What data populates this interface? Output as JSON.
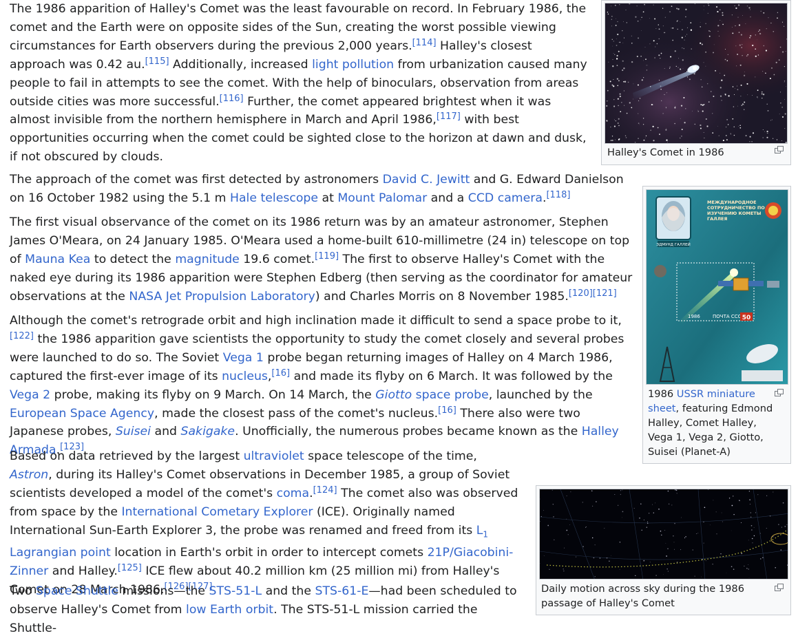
{
  "p1": {
    "t1": "The 1986 apparition of Halley's Comet was the least favourable on record. In February 1986, the comet and the Earth were on opposite sides of the Sun, creating the worst possible viewing circumstances for Earth observers during the previous 2,000 years.",
    "r1": "[114]",
    "t2": " Halley's closest approach was 0.42 au.",
    "r2": "[115]",
    "t3": " Additionally, increased ",
    "l1": "light pollution",
    "t4": " from urbanization caused many people to fail in attempts to see the comet. With the help of binoculars, observation from areas outside cities was more successful.",
    "r3": "[116]",
    "t5": " Further, the comet appeared brightest when it was almost invisible from the northern hemisphere in March and April 1986,",
    "r4": "[117]",
    "t6": " with best opportunities occurring when the comet could be sighted close to the horizon at dawn and dusk, if not obscured by clouds."
  },
  "p2": {
    "t1": "The approach of the comet was first detected by astronomers ",
    "l1": "David C. Jewitt",
    "t2": " and G. Edward Danielson on 16 October 1982 using the 5.1 m ",
    "l2": "Hale telescope",
    "t3": " at ",
    "l3": "Mount Palomar",
    "t4": " and a ",
    "l4": "CCD camera",
    "t5": ".",
    "r1": "[118]"
  },
  "p3": {
    "t1": "The first visual observance of the comet on its 1986 return was by an amateur astronomer, Stephen James O'Meara, on 24 January 1985. O'Meara used a home-built 610-millimetre (24 in) telescope on top of ",
    "l1": "Mauna Kea",
    "t2": " to detect the ",
    "l2": "magnitude",
    "t3": " 19.6 comet.",
    "r1": "[119]",
    "t4": " The first to observe Halley's Comet with the naked eye during its 1986 apparition were Stephen Edberg (then serving as the coordinator for amateur observations at the ",
    "l3": "NASA Jet Propulsion Laboratory",
    "t5": ") and Charles Morris on 8 November 1985.",
    "r2": "[120]",
    "r3": "[121]"
  },
  "p4": {
    "t1": "Although the comet's retrograde orbit and high inclination made it difficult to send a space probe to it,",
    "r1": "[122]",
    "t2": " the 1986 apparition gave scientists the opportunity to study the comet closely and several probes were launched to do so. The Soviet ",
    "l1": "Vega 1",
    "t3": " probe began returning images of Halley on 4 March 1986, captured the first-ever image of its ",
    "l2": "nucleus",
    "t4": ",",
    "r2": "[16]",
    "t5": " and made its flyby on 6 March. It was followed by the ",
    "l3": "Vega 2",
    "t6": " probe, making its flyby on 9 March. On 14 March, the ",
    "l4i": "Giotto",
    "l4": " space probe",
    "t7": ", launched by the ",
    "l5": "European Space Agency",
    "t8": ", made the closest pass of the comet's nucleus.",
    "r3": "[16]",
    "t9": " There also were two Japanese probes, ",
    "l6": "Suisei",
    "t10": " and ",
    "l7": "Sakigake",
    "t11": ". Unofficially, the numerous probes became known as the ",
    "l8": "Halley Armada",
    "t12": ".",
    "r4": "[123]"
  },
  "p5": {
    "t1": "Based on data retrieved by the largest ",
    "l1": "ultraviolet",
    "t2": " space telescope of the time, ",
    "l2": "Astron",
    "t3": ", during its Halley's Comet observations in December 1985, a group of Soviet scientists developed a model of the comet's ",
    "l3": "coma",
    "t4": ".",
    "r1": "[124]",
    "t5": " The comet also was observed from space by the ",
    "l4": "International Cometary Explorer",
    "t6": " (ICE). Originally named International Sun-Earth Explorer 3, the probe was renamed and freed from its ",
    "l5a": "L",
    "l5sub": "1",
    "l5b": " Lagrangian point",
    "t7": " location in Earth's orbit in order to intercept comets ",
    "l6": "21P/Giacobini-Zinner",
    "t8": " and Halley.",
    "r2": "[125]",
    "t9": " ICE flew about 40.2 million km (25 million mi) from Halley's Comet on 28 March 1986.",
    "r3": "[126]",
    "r4": "[127]"
  },
  "p6": {
    "t1": "Two ",
    "l1": "Space Shuttle",
    "t2": " missions—the ",
    "l2": "STS-51-L",
    "t3": " and the ",
    "l3": "STS-61-E",
    "t4": "—had been scheduled to observe Halley's Comet from ",
    "l4": "low Earth orbit",
    "t5": ". The STS-51-L mission carried the Shuttle-"
  },
  "fig1": {
    "caption": "Halley's Comet in 1986"
  },
  "fig2": {
    "c1": "1986 ",
    "l1": "USSR miniature sheet",
    "c2": ", featuring Edmond Halley, Comet Halley, Vega 1, Vega 2, Giotto, Suisei (Planet-A)",
    "stamp_text": "МЕЖДУНАРОДНОЕ СОТРУДНИЧЕСТВО ПО ИЗУЧЕНИЮ КОМЕТЫ ГАЛЛЕЯ",
    "stamp_name": "ЭДМУНД ГАЛЛЕЙ",
    "stamp_post": "ПОЧТА СССР",
    "stamp_value": "50",
    "stamp_year": "1986"
  },
  "fig3": {
    "caption": "Daily motion across sky during the 1986 passage of Halley's Comet"
  },
  "icons": {
    "magnify": "magnify-icon"
  },
  "colors": {
    "link": "#3366cc",
    "text": "#202122",
    "thumb_bg": "#f8f9fa",
    "thumb_border": "#c8ccd1"
  }
}
